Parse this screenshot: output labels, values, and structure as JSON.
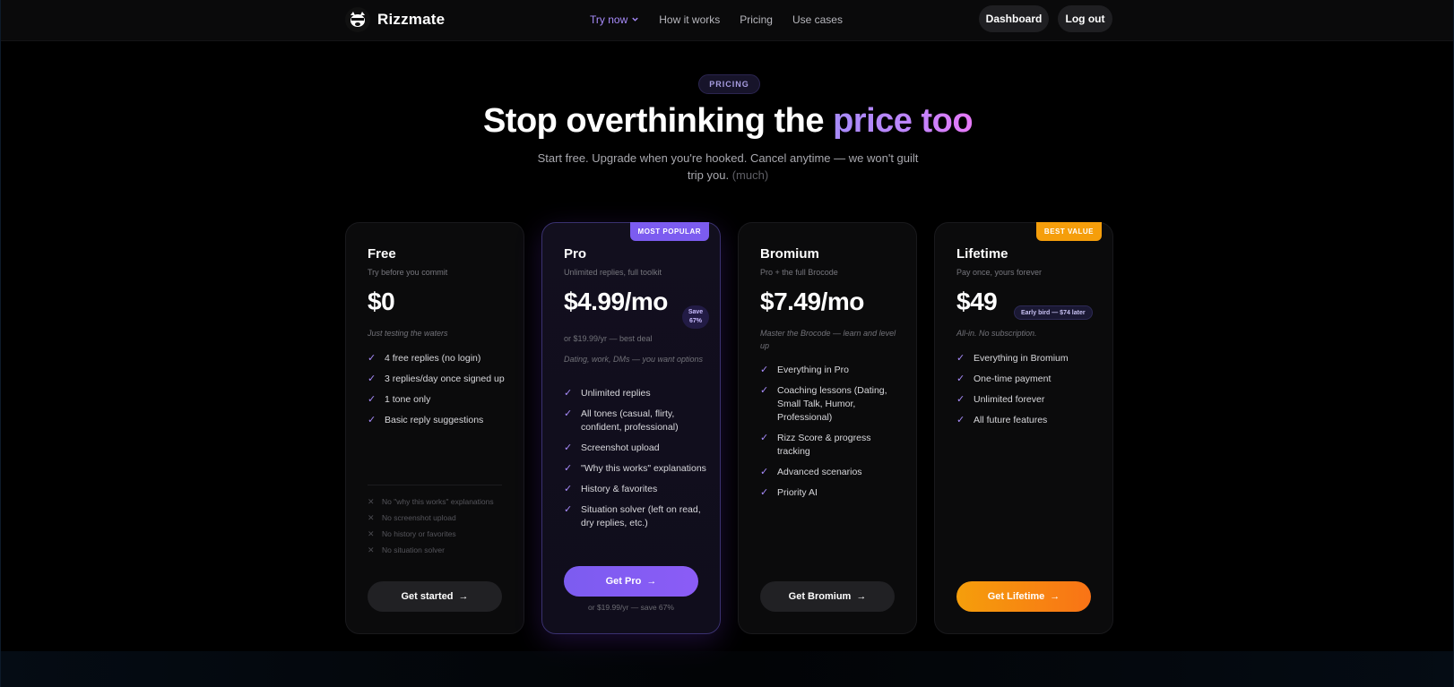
{
  "brand": {
    "name": "Rizzmate",
    "logo_icon": "cat-logo-icon"
  },
  "nav": {
    "links": [
      "Try now",
      "How it works",
      "Pricing",
      "Use cases"
    ],
    "dashboard_label": "Dashboard",
    "logout_label": "Log out"
  },
  "hero": {
    "pill": "PRICING",
    "headline_main": "Stop overthinking the ",
    "headline_accent": "price too",
    "subline": "Start free. Upgrade when you're hooked. Cancel anytime — we won't guilt trip you. ",
    "subline_muted": "(much)"
  },
  "plans": [
    {
      "name": "Free",
      "tagline": "Try before you commit",
      "price": "$0",
      "note": "Just testing the waters",
      "features": [
        "4 free replies (no login)",
        "3 replies/day once signed up",
        "1 tone only",
        "Basic reply suggestions"
      ],
      "excluded": [
        "No \"why this works\" explanations",
        "No screenshot upload",
        "No history or favorites",
        "No situation solver"
      ],
      "cta": "Get started"
    },
    {
      "name": "Pro",
      "ribbon": "MOST POPULAR",
      "tagline": "Unlimited replies, full toolkit",
      "price": "$4.99/mo",
      "save_badge_line1": "Save",
      "save_badge_line2": "67%",
      "alt_price": "or $19.99/yr — best deal",
      "note": "Dating, work, DMs — you want options",
      "features": [
        "Unlimited replies",
        "All tones (casual, flirty, confident, professional)",
        "Screenshot upload",
        "\"Why this works\" explanations",
        "History & favorites",
        "Situation solver (left on read, dry replies, etc.)"
      ],
      "cta": "Get Pro",
      "cta_footnote": "or $19.99/yr — save 67%"
    },
    {
      "name": "Bromium",
      "tagline": "Pro + the full Brocode",
      "price": "$7.49/mo",
      "note": "Master the Brocode — learn and level up",
      "features": [
        "Everything in Pro",
        "Coaching lessons (Dating, Small Talk, Humor, Professional)",
        "Rizz Score & progress tracking",
        "Advanced scenarios",
        "Priority AI"
      ],
      "cta": "Get Bromium"
    },
    {
      "name": "Lifetime",
      "ribbon": "BEST VALUE",
      "tagline": "Pay once, yours forever",
      "price": "$49",
      "early_badge": "Early bird — $74 later",
      "note": "All-in. No subscription.",
      "features": [
        "Everything in Bromium",
        "One-time payment",
        "Unlimited forever",
        "All future features"
      ],
      "cta": "Get Lifetime"
    }
  ],
  "colors": {
    "accent": "#a78bfa",
    "pro_cta": "#8b5cf6",
    "lifetime_cta": "#f59e0b"
  }
}
